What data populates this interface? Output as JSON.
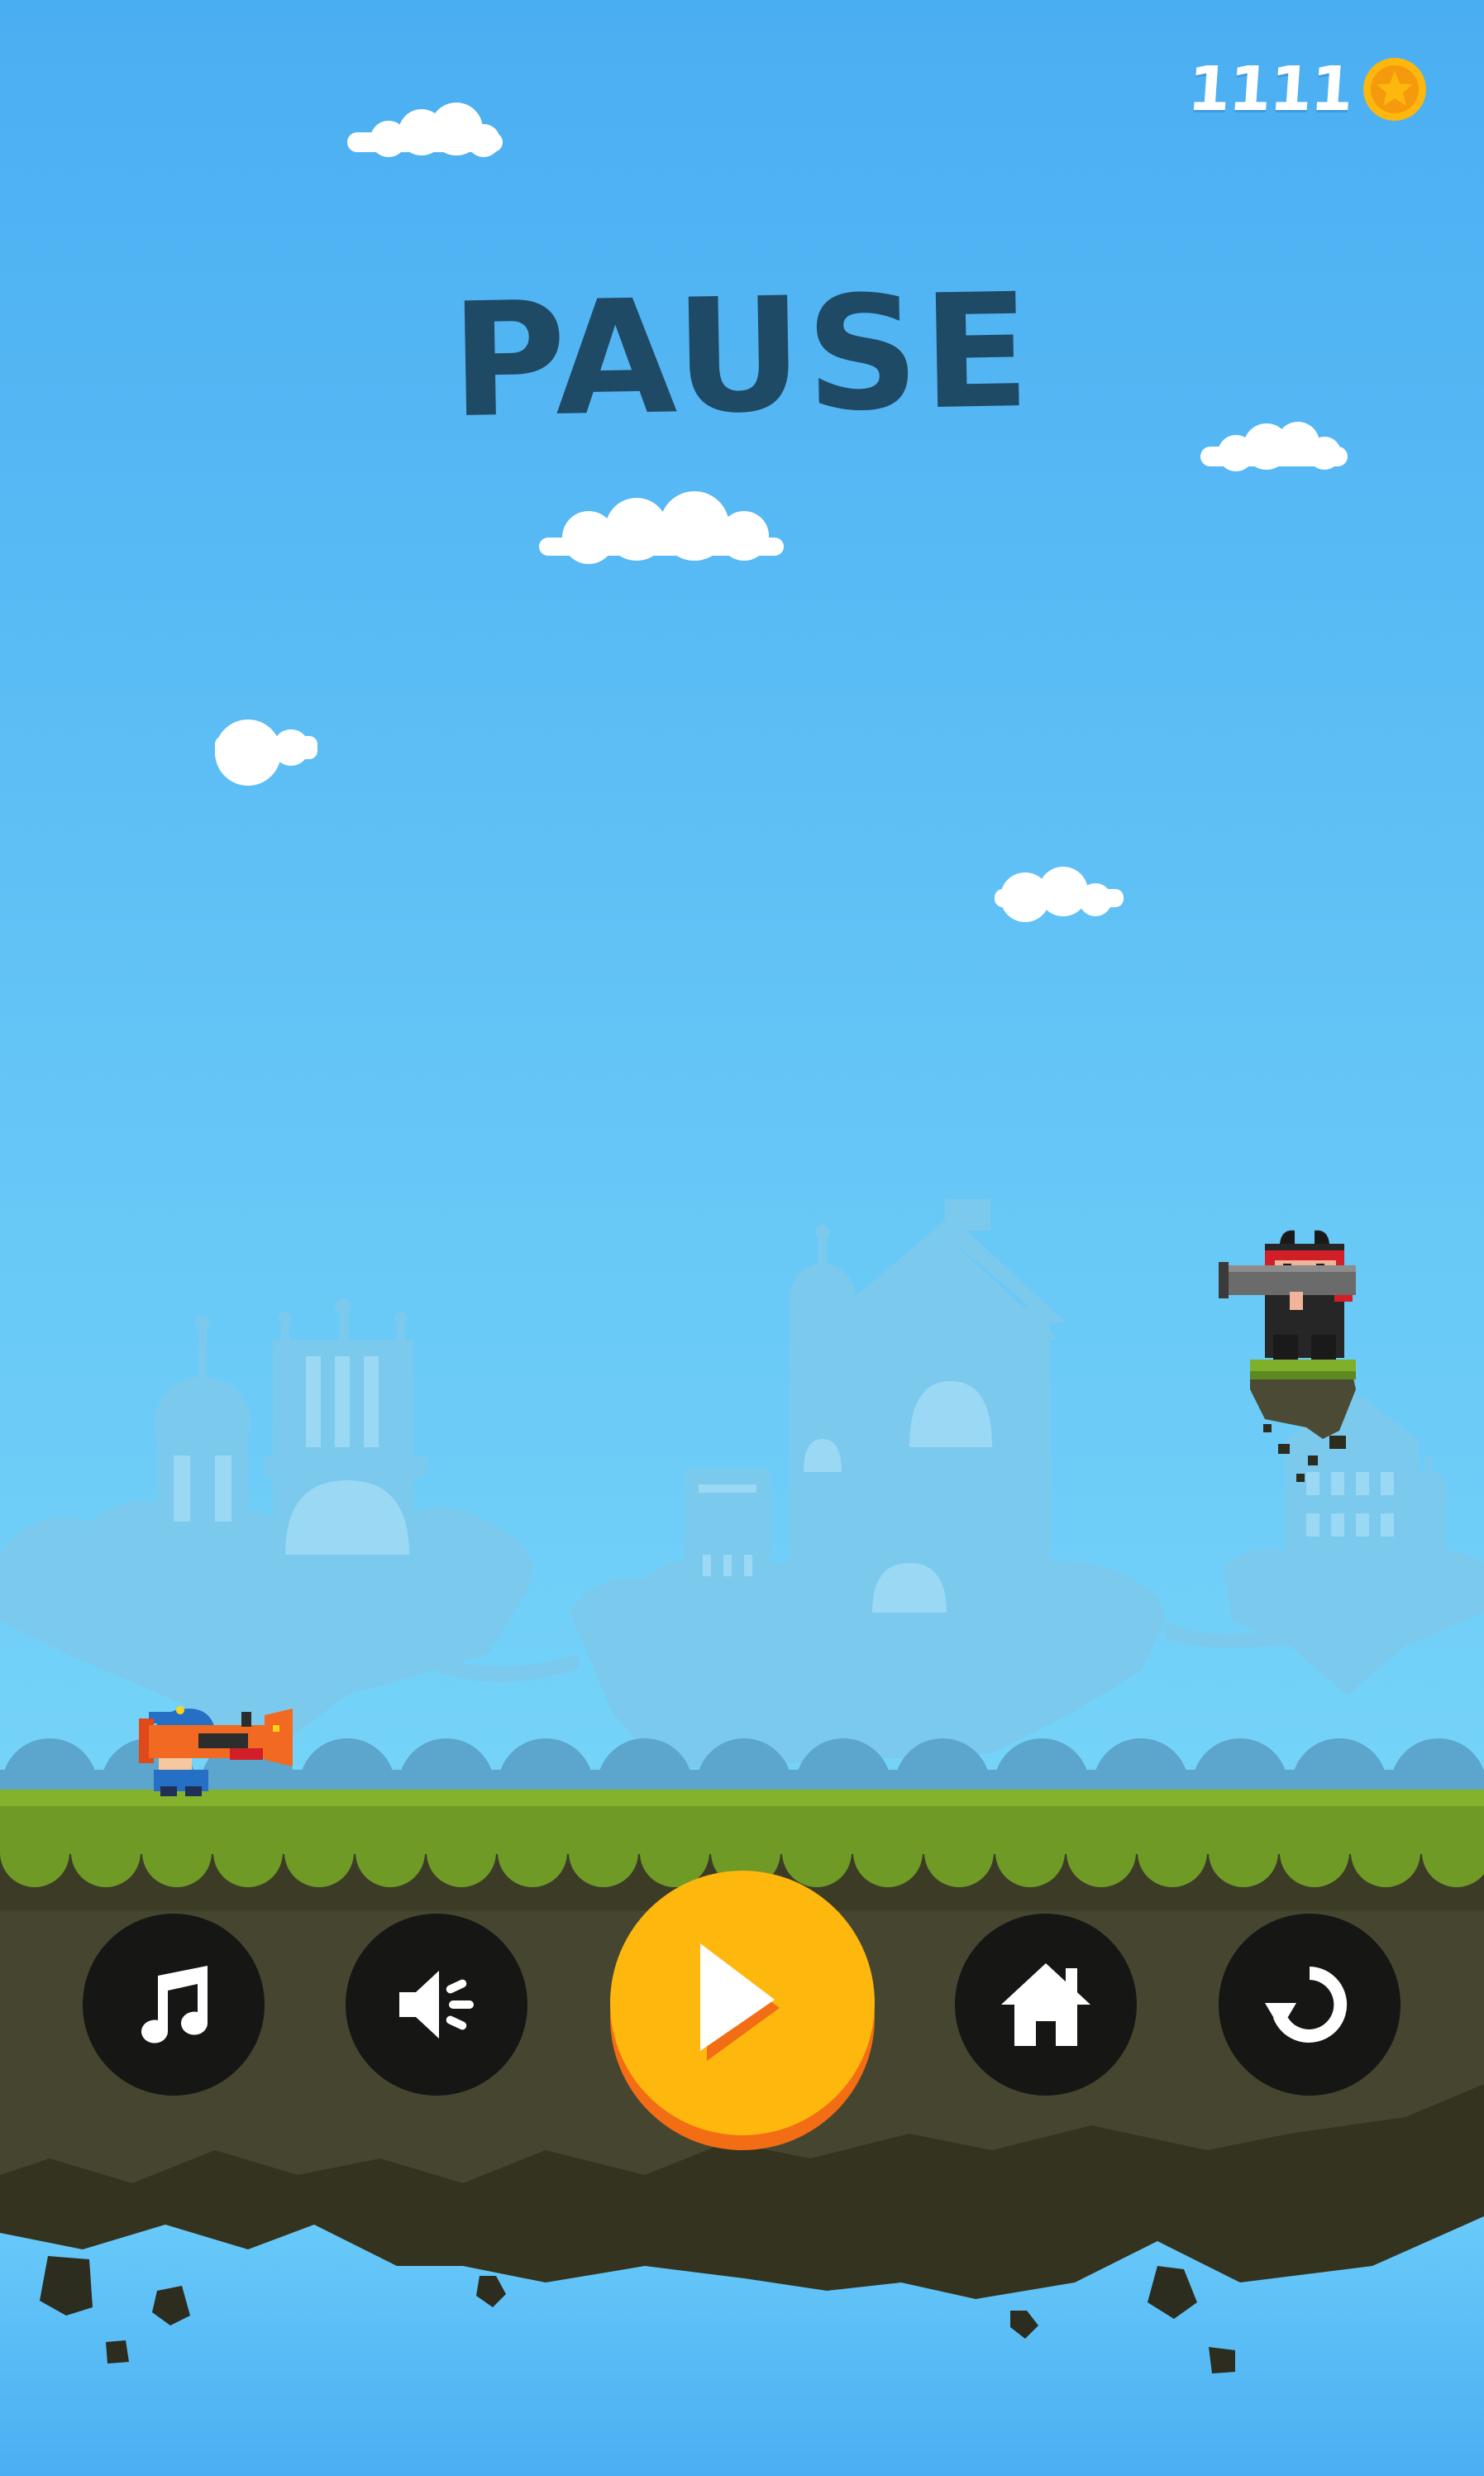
{
  "hud": {
    "coins": "1111",
    "coin_icon": "star-coin-icon"
  },
  "pause_menu": {
    "title": "PAUSE",
    "buttons": [
      {
        "id": "music",
        "icon": "music-note-icon"
      },
      {
        "id": "sound",
        "icon": "speaker-icon"
      },
      {
        "id": "resume",
        "icon": "play-icon"
      },
      {
        "id": "home",
        "icon": "home-icon"
      },
      {
        "id": "restart",
        "icon": "restart-icon"
      }
    ]
  },
  "colors": {
    "sky_top": "#4aaef2",
    "sky_bottom": "#86e2fb",
    "title": "#1f4a66",
    "grass": "#6f9a25",
    "ground": "#33331f",
    "button_dark": "#161714",
    "play_button": "#fdb70d",
    "play_button_shadow": "#f36d14",
    "coin": "#fdb70d"
  }
}
